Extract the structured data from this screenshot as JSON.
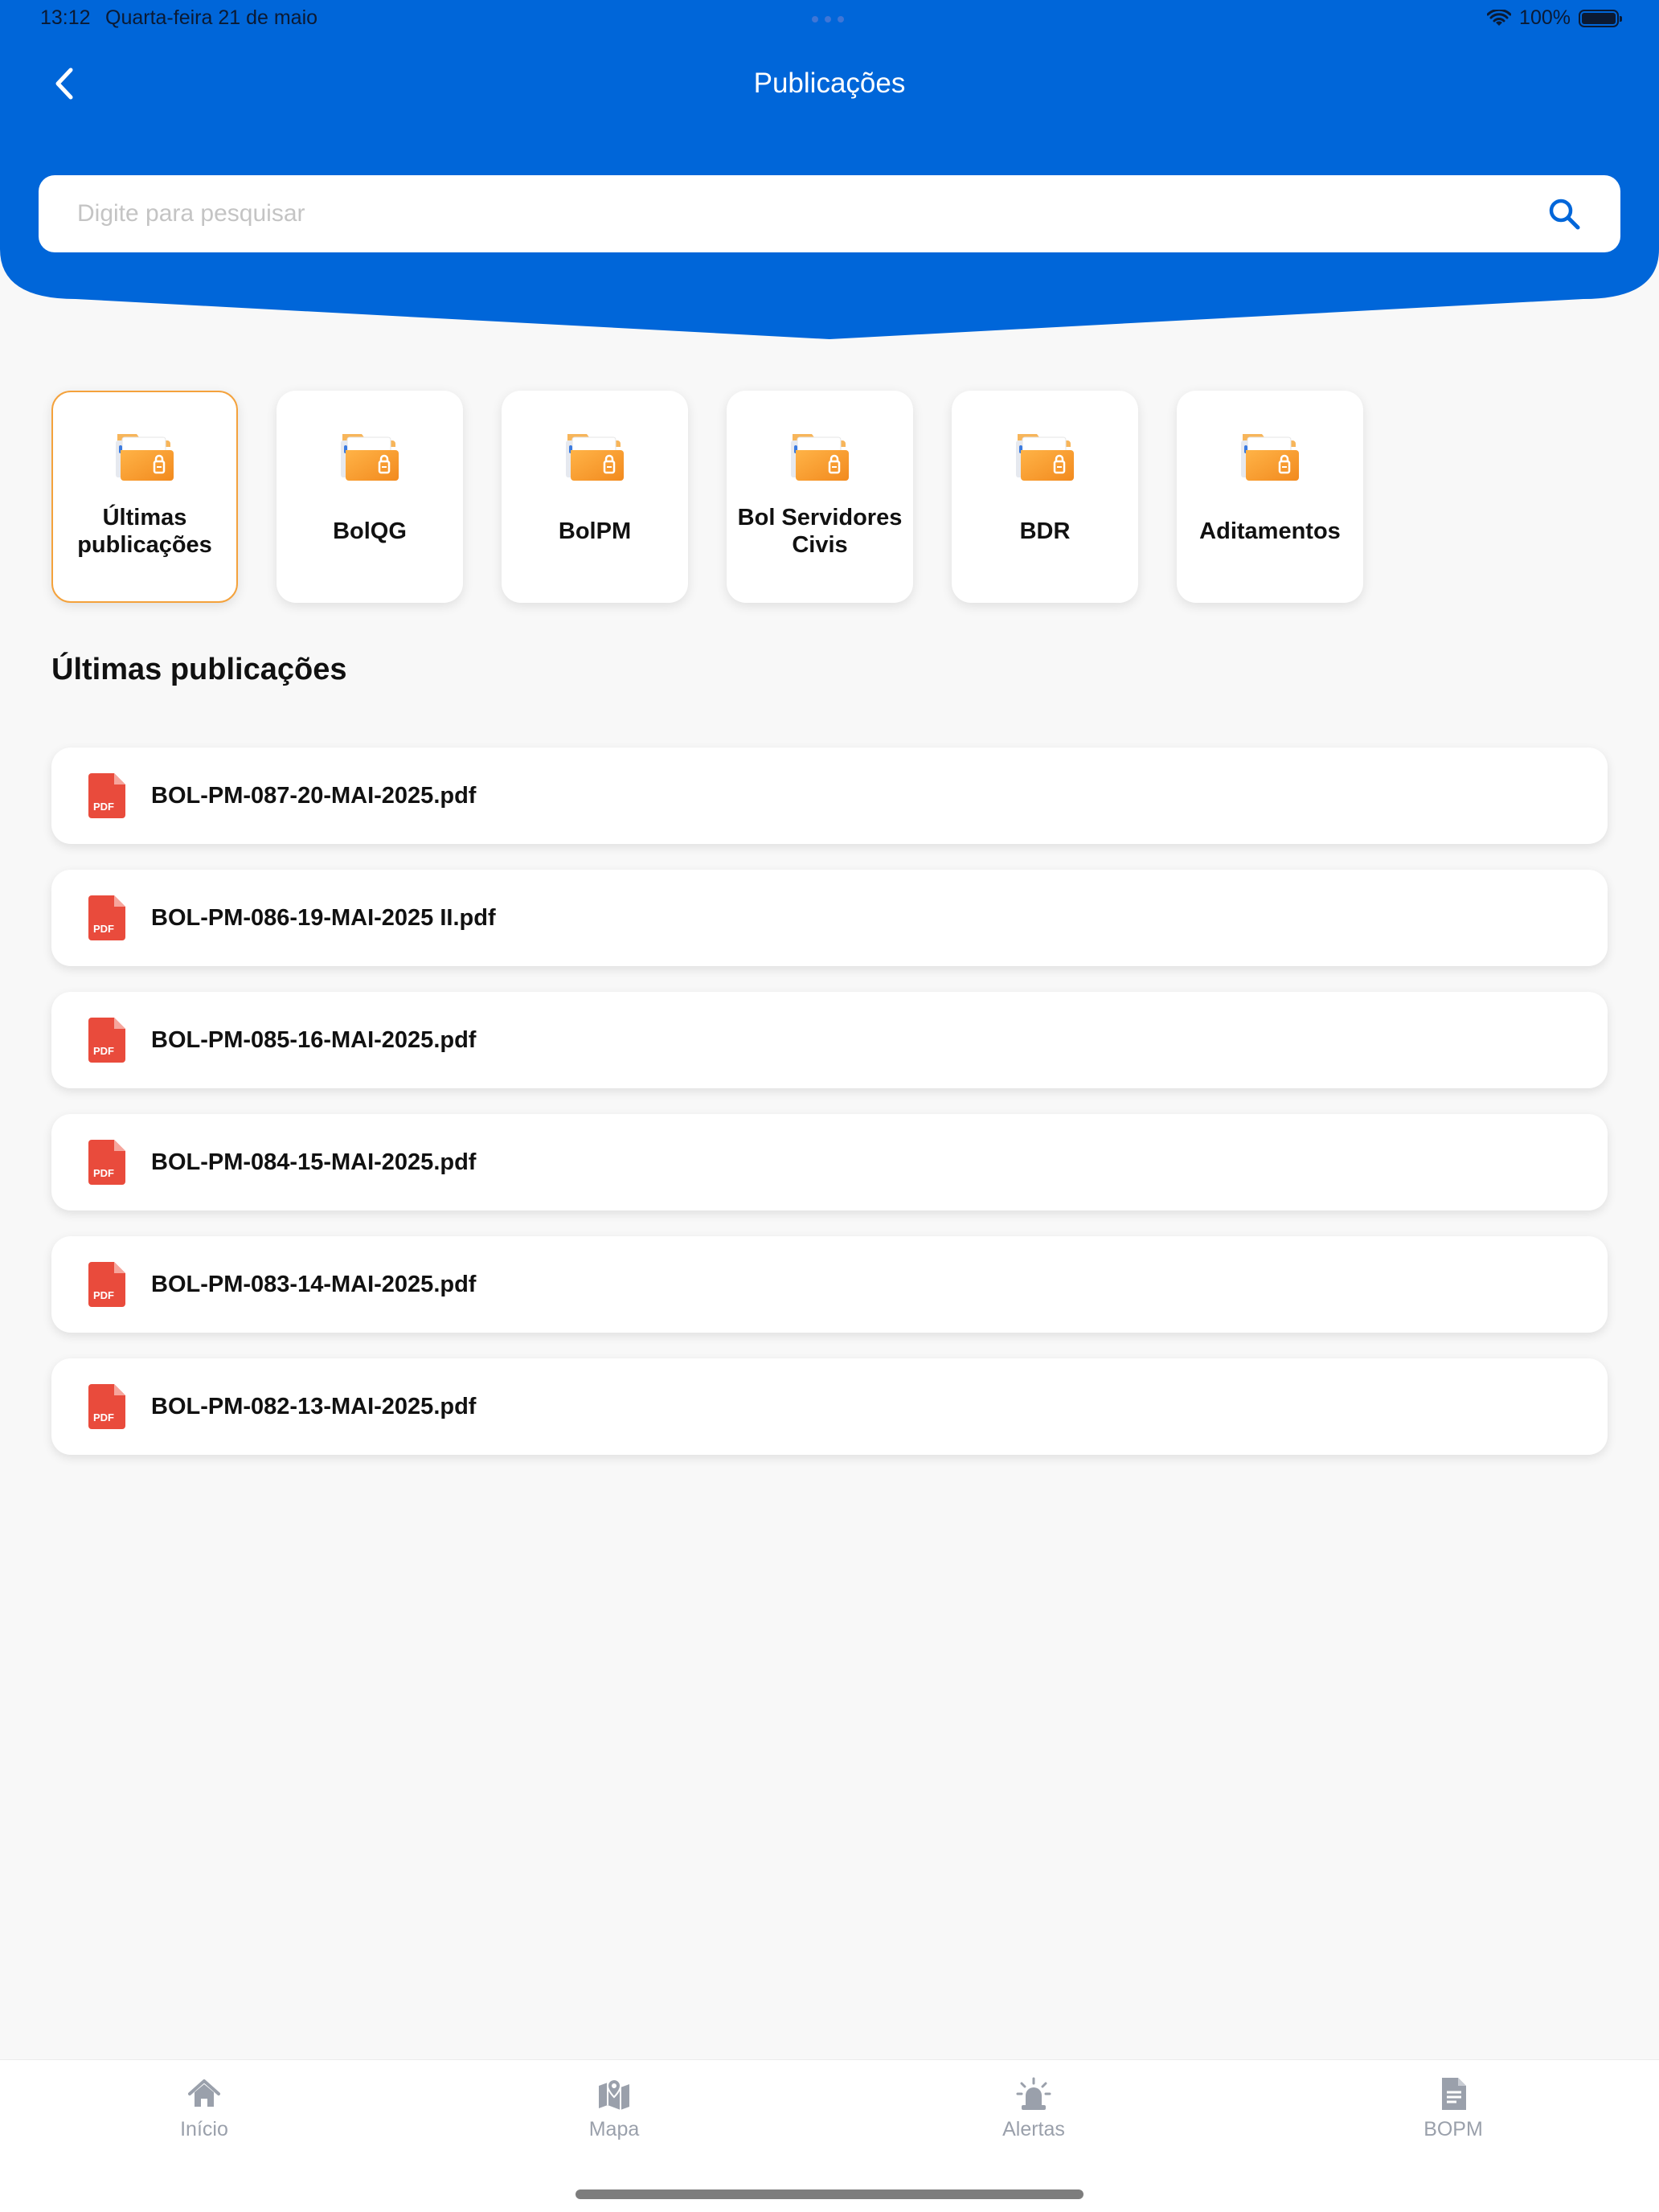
{
  "status_bar": {
    "time": "13:12",
    "date": "Quarta-feira 21 de maio",
    "battery": "100%"
  },
  "header": {
    "title": "Publicações",
    "back_icon": "chevron-left-icon",
    "color": "#0066d9"
  },
  "search": {
    "placeholder": "Digite para pesquisar",
    "value": "",
    "icon": "search-icon"
  },
  "categories": [
    {
      "label": "Últimas publicações",
      "active": true
    },
    {
      "label": "BolQG",
      "active": false
    },
    {
      "label": "BolPM",
      "active": false
    },
    {
      "label": "Bol Servidores Civis",
      "active": false
    },
    {
      "label": "BDR",
      "active": false
    },
    {
      "label": "Aditamentos",
      "active": false
    }
  ],
  "section_title": "Últimas publicações",
  "files": [
    {
      "name": "BOL-PM-087-20-MAI-2025.pdf"
    },
    {
      "name": "BOL-PM-086-19-MAI-2025 II.pdf"
    },
    {
      "name": "BOL-PM-085-16-MAI-2025.pdf"
    },
    {
      "name": "BOL-PM-084-15-MAI-2025.pdf"
    },
    {
      "name": "BOL-PM-083-14-MAI-2025.pdf"
    },
    {
      "name": "BOL-PM-082-13-MAI-2025.pdf"
    }
  ],
  "pdf_icon_text": "PDF",
  "bottom_nav": [
    {
      "label": "Início",
      "icon": "home-icon"
    },
    {
      "label": "Mapa",
      "icon": "map-icon"
    },
    {
      "label": "Alertas",
      "icon": "siren-icon"
    },
    {
      "label": "BOPM",
      "icon": "document-icon"
    }
  ],
  "colors": {
    "accent": "#f4a23c",
    "pdf_red": "#e94b3c",
    "nav_gray": "#9aa0ab"
  }
}
